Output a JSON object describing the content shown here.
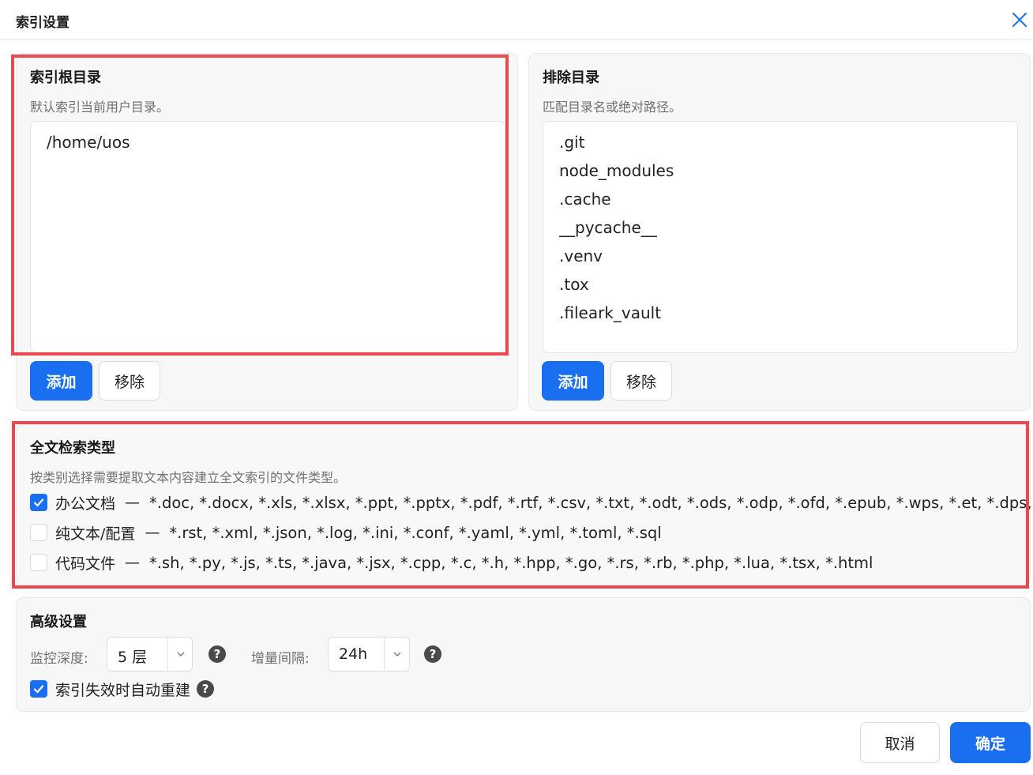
{
  "dialog": {
    "title": "索引设置"
  },
  "root_panel": {
    "title": "索引根目录",
    "description": "默认索引当前用户目录。",
    "items": [
      "/home/uos"
    ],
    "add_label": "添加",
    "remove_label": "移除"
  },
  "exclude_panel": {
    "title": "排除目录",
    "description": "匹配目录名或绝对路径。",
    "items": [
      ".git",
      "node_modules",
      ".cache",
      "__pycache__",
      ".venv",
      ".tox",
      ".fileark_vault"
    ],
    "add_label": "添加",
    "remove_label": "移除"
  },
  "fulltext_panel": {
    "title": "全文检索类型",
    "description": "按类别选择需要提取文本内容建立全文索引的文件类型。",
    "categories": [
      {
        "label": "办公文档",
        "separator": "—",
        "checked": true,
        "extensions": "*.doc, *.docx, *.xls, *.xlsx, *.ppt, *.pptx, *.pdf, *.rtf, *.csv, *.txt, *.odt, *.ods, *.odp, *.ofd, *.epub, *.wps, *.et, *.dps, *.md"
      },
      {
        "label": "纯文本/配置",
        "separator": "—",
        "checked": false,
        "extensions": "*.rst, *.xml, *.json, *.log, *.ini, *.conf, *.yaml, *.yml, *.toml, *.sql"
      },
      {
        "label": "代码文件",
        "separator": "—",
        "checked": false,
        "extensions": "*.sh, *.py, *.js, *.ts, *.java, *.jsx, *.cpp, *.c, *.h, *.hpp, *.go, *.rs, *.rb, *.php, *.lua, *.tsx, *.html"
      }
    ]
  },
  "advanced_panel": {
    "title": "高级设置",
    "depth_label": "监控深度:",
    "depth_value": "5 层",
    "interval_label": "增量间隔:",
    "interval_value": "24h",
    "help_glyph": "?",
    "auto_rebuild_label": "索引失效时自动重建",
    "auto_rebuild_checked": true
  },
  "footer": {
    "cancel_label": "取消",
    "ok_label": "确定"
  },
  "colors": {
    "accent": "#1a6ff0",
    "highlight": "#ea4a4f"
  },
  "icons": [
    "close-icon",
    "check-icon",
    "chevron-down-icon",
    "help-icon"
  ]
}
